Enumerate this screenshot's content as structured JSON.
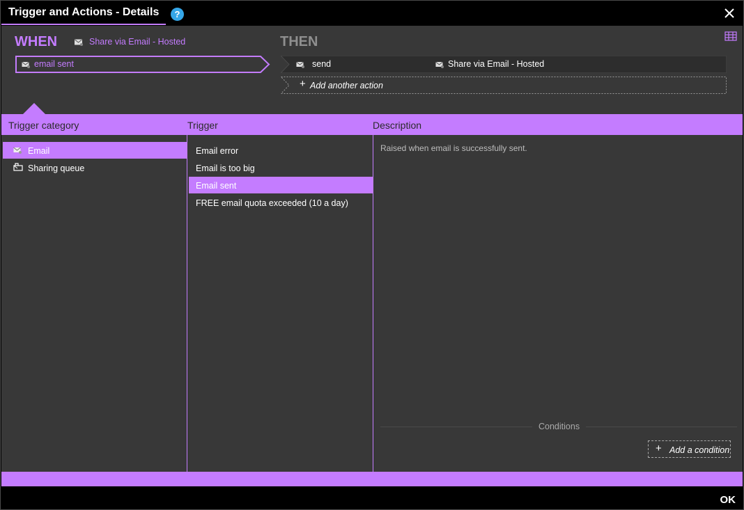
{
  "window": {
    "title": "Trigger and Actions - Details",
    "help_glyph": "?",
    "close_icon": "close-icon"
  },
  "header": {
    "when_label": "WHEN",
    "when_source": "Share via Email - Hosted",
    "trigger_value": "email sent",
    "then_label": "THEN",
    "actions": [
      {
        "name": "send",
        "target": "Share via Email - Hosted"
      }
    ],
    "add_action_label": "Add another action"
  },
  "columns": {
    "category_header": "Trigger category",
    "trigger_header": "Trigger",
    "description_header": "Description"
  },
  "categories": [
    {
      "label": "Email",
      "icon": "mail-icon",
      "selected": true
    },
    {
      "label": "Sharing queue",
      "icon": "queue-icon",
      "selected": false
    }
  ],
  "triggers": [
    {
      "label": "Email error",
      "selected": false
    },
    {
      "label": "Email is too big",
      "selected": false
    },
    {
      "label": "Email sent",
      "selected": true
    },
    {
      "label": "FREE email quota exceeded (10 a day)",
      "selected": false
    }
  ],
  "description": {
    "text": "Raised when email is successfully sent.",
    "conditions_label": "Conditions",
    "add_condition_label": "Add a condition"
  },
  "footer": {
    "ok_label": "OK"
  },
  "colors": {
    "accent": "#c47cff",
    "panel": "#383838",
    "background": "#000000",
    "help_blue": "#35a6e8"
  }
}
